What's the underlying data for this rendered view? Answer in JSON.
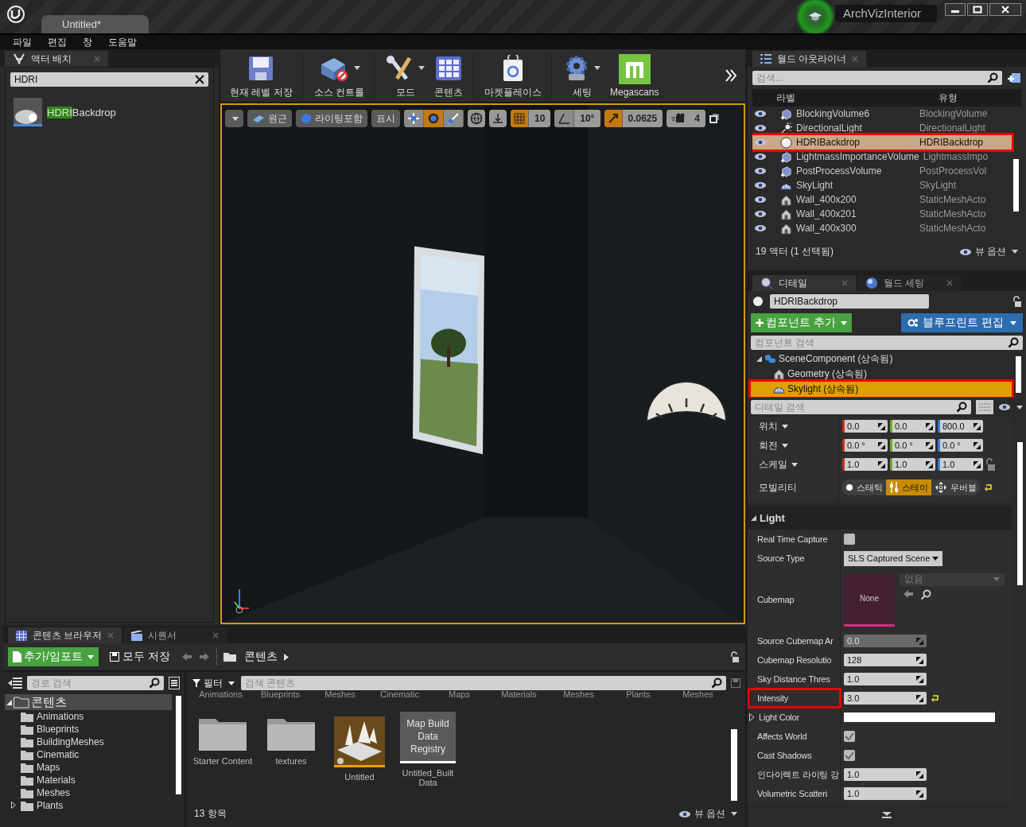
{
  "title_bar": {
    "tab": "Untitled*",
    "project": "ArchVizInterior"
  },
  "menu": [
    "파일",
    "편집",
    "창",
    "도움말"
  ],
  "placement": {
    "tab": "액터 배치",
    "search": "HDRI",
    "results": [
      {
        "match": "HDRI",
        "rest": "Backdrop"
      }
    ]
  },
  "toolbar": [
    {
      "label": "현재 레벨 저장",
      "kind": "save",
      "dropdown": false
    },
    {
      "label": "소스 컨트롤",
      "kind": "source",
      "dropdown": true
    },
    {
      "label": "모드",
      "kind": "modes",
      "dropdown": true
    },
    {
      "label": "콘텐츠",
      "kind": "content",
      "dropdown": false
    },
    {
      "label": "마켓플레이스",
      "kind": "market",
      "dropdown": false
    },
    {
      "label": "세팅",
      "kind": "settings",
      "dropdown": true
    },
    {
      "label": "Megascans",
      "kind": "megascans",
      "dropdown": false
    }
  ],
  "viewport": {
    "view": "원근",
    "lighting": "라이팅포함",
    "show": "표시",
    "transform_tools": [
      {
        "kind": "move",
        "selected": false
      },
      {
        "kind": "rotate",
        "selected": true
      },
      {
        "kind": "scale",
        "selected": false
      }
    ],
    "snaps": [
      {
        "kind": "grid",
        "value": "10",
        "on": true
      },
      {
        "kind": "angle",
        "value": "10°",
        "on": false
      },
      {
        "kind": "scale",
        "value": "0.0625",
        "on": true
      }
    ],
    "camera_speed": "4"
  },
  "outliner": {
    "tab": "월드 아웃라이너",
    "search": "검색...",
    "columns": [
      "라벨",
      "유형"
    ],
    "rows": [
      {
        "label": "BlockingVolume6",
        "type": "BlockingVolume",
        "kind": "volume",
        "selected": false,
        "annotated": false
      },
      {
        "label": "DirectionalLight",
        "type": "DirectionalLight",
        "kind": "sun",
        "selected": false,
        "annotated": false
      },
      {
        "label": "HDRIBackdrop",
        "type": "HDRIBackdrop",
        "kind": "sphere",
        "selected": true,
        "annotated": true
      },
      {
        "label": "LightmassImportanceVolume",
        "type": "LightmassImpo",
        "kind": "volume",
        "selected": false,
        "annotated": false
      },
      {
        "label": "PostProcessVolume",
        "type": "PostProcessVol",
        "kind": "volume",
        "selected": false,
        "annotated": false
      },
      {
        "label": "SkyLight",
        "type": "SkyLight",
        "kind": "skylight",
        "selected": false,
        "annotated": false
      },
      {
        "label": "Wall_400x200",
        "type": "StaticMeshActo",
        "kind": "mesh",
        "selected": false,
        "annotated": false
      },
      {
        "label": "Wall_400x201",
        "type": "StaticMeshActo",
        "kind": "mesh",
        "selected": false,
        "annotated": false
      },
      {
        "label": "Wall_400x300",
        "type": "StaticMeshActo",
        "kind": "mesh",
        "selected": false,
        "annotated": false
      }
    ],
    "footer": "19 액터 (1 선택됨)",
    "view_options": "뷰 옵션"
  },
  "details": {
    "tabs": [
      {
        "label": "디테일",
        "selected": true
      },
      {
        "label": "월드 세팅",
        "selected": false
      }
    ],
    "actor_name": "HDRIBackdrop",
    "add_component": "컴포넌트 추가",
    "edit_blueprint": "블루프린트 편집",
    "component_search": "컴포넌트 검색",
    "components": [
      {
        "label": "SceneComponent (상속됨)",
        "kind": "scene",
        "selected": false,
        "annotated": false,
        "expanded": true,
        "children": [
          {
            "label": "Geometry (상속됨)",
            "kind": "mesh",
            "selected": false,
            "annotated": false
          },
          {
            "label": "Skylight (상속됨)",
            "kind": "skylight",
            "selected": true,
            "annotated": true
          }
        ]
      }
    ],
    "details_search": "디테일 검색",
    "transform": [
      {
        "label": "위치",
        "values": [
          "0.0",
          "0.0",
          "800.0"
        ]
      },
      {
        "label": "회전",
        "values": [
          "0.0 °",
          "0.0 °",
          "0.0 °"
        ]
      },
      {
        "label": "스케일",
        "values": [
          "1.0",
          "1.0",
          "1.0"
        ]
      }
    ],
    "mobility": {
      "label": "모빌리티",
      "options": [
        {
          "label": "스태틱",
          "kind": "dot",
          "selected": false
        },
        {
          "label": "스테이",
          "kind": "slider",
          "selected": true
        },
        {
          "label": "무버블",
          "kind": "move",
          "selected": false
        }
      ]
    },
    "section": {
      "title": "Light",
      "expanded": true,
      "properties": [
        {
          "kind": "checkbox",
          "label": "Real Time Capture",
          "checked": false,
          "annotated": false
        },
        {
          "kind": "dropdown",
          "label": "Source Type",
          "value": "SLS Captured Scene",
          "annotated": false
        },
        {
          "kind": "asset",
          "label": "Cubemap",
          "thumb": "None",
          "placeholder": "없음",
          "annotated": false
        },
        {
          "kind": "number",
          "label": "Source Cubemap Ar",
          "value": "0.0",
          "disabled": true,
          "reset": false,
          "annotated": false
        },
        {
          "kind": "number",
          "label": "Cubemap Resolutio",
          "value": "128",
          "disabled": false,
          "reset": false,
          "annotated": false
        },
        {
          "kind": "number",
          "label": "Sky Distance Thres",
          "value": "1.0",
          "disabled": false,
          "reset": false,
          "annotated": false
        },
        {
          "kind": "number",
          "label": "Intensity",
          "value": "3.0",
          "disabled": false,
          "reset": true,
          "annotated": true
        },
        {
          "kind": "color",
          "label": "Light Color",
          "annotated": false
        },
        {
          "kind": "checkbox",
          "label": "Affects World",
          "checked": true,
          "annotated": false
        },
        {
          "kind": "checkbox",
          "label": "Cast Shadows",
          "checked": true,
          "annotated": false
        },
        {
          "kind": "number",
          "label": "인다이렉트 라이팅 강",
          "value": "1.0",
          "disabled": false,
          "reset": false,
          "annotated": false
        },
        {
          "kind": "number",
          "label": "Volumetric Scatteri",
          "value": "1.0",
          "disabled": false,
          "reset": false,
          "annotated": false
        }
      ]
    }
  },
  "content_browser": {
    "tabs": [
      {
        "label": "콘텐츠 브라우저",
        "selected": true
      },
      {
        "label": "시퀀서",
        "selected": false
      }
    ],
    "add_import": "추가/임포트",
    "save_all": "모두 저장",
    "path": "콘텐츠",
    "path_search": "경로 검색",
    "filter": "필터",
    "search": "검색 콘텐츠",
    "tree": {
      "label": "콘텐츠",
      "expanded": true,
      "children": [
        {
          "label": "Animations",
          "has_children": false
        },
        {
          "label": "Blueprints",
          "has_children": false
        },
        {
          "label": "BuildingMeshes",
          "has_children": false
        },
        {
          "label": "Cinematic",
          "has_children": false
        },
        {
          "label": "Maps",
          "has_children": false
        },
        {
          "label": "Materials",
          "has_children": false
        },
        {
          "label": "Meshes",
          "has_children": false
        },
        {
          "label": "Plants",
          "has_children": true
        }
      ]
    },
    "scrolled_labels": [
      "Animations",
      "Blueprints",
      "Meshes",
      "Cinematic",
      "Maps",
      "Materials",
      "Meshes",
      "Plants",
      "Meshes"
    ],
    "assets": [
      {
        "kind": "folder",
        "name": "Starter Content"
      },
      {
        "kind": "folder",
        "name": "textures"
      },
      {
        "kind": "map",
        "name": "Untitled"
      },
      {
        "kind": "registry",
        "thumb": "Map Build Data Registry",
        "name": "Untitled_Built Data"
      }
    ],
    "count": "13 항목",
    "view_options": "뷰 옵션"
  }
}
